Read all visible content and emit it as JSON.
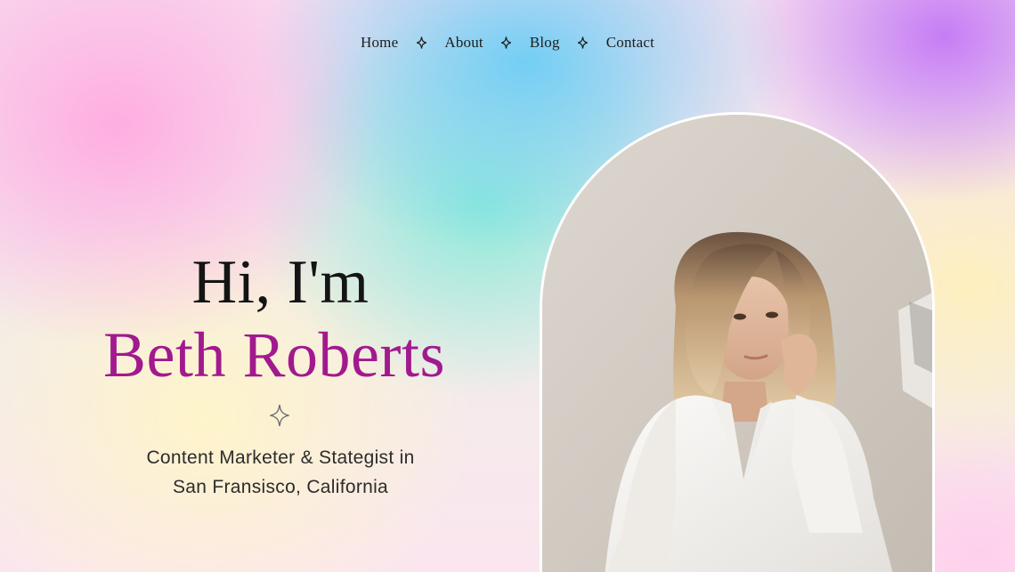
{
  "nav": {
    "items": [
      {
        "label": "Home"
      },
      {
        "label": "About"
      },
      {
        "label": "Blog"
      },
      {
        "label": "Contact"
      }
    ],
    "separator_icon": "four-point-star-icon"
  },
  "hero": {
    "greeting": "Hi, I'm",
    "name": "Beth Roberts",
    "divider_icon": "four-point-star-icon",
    "subtitle_line1": "Content Marketer & Stategist in",
    "subtitle_line2": "San Fransisco, California"
  },
  "photo": {
    "frame_shape": "arch",
    "frame_border_color": "#ffffff"
  },
  "colors": {
    "name_accent": "#a2198e",
    "text": "#1d1d1d",
    "gradient": [
      "#ffaae1",
      "#6ecdf5",
      "#c378f5",
      "#82ebd7",
      "#fff5c8"
    ]
  }
}
